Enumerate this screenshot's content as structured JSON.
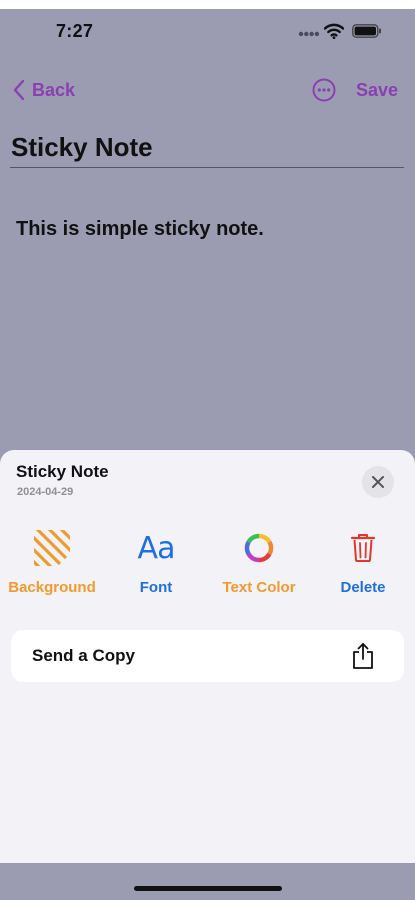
{
  "status_bar": {
    "time": "7:27"
  },
  "nav": {
    "back_label": "Back",
    "save_label": "Save",
    "accent_color": "#8a3fb3"
  },
  "note": {
    "title": "Sticky Note",
    "body": "This is simple sticky note."
  },
  "sheet": {
    "title": "Sticky Note",
    "date": "2024-04-29",
    "actions": [
      {
        "label": "Background",
        "icon": "stripes-icon",
        "color": "#f29a2e"
      },
      {
        "label": "Font",
        "icon": "font-aa-icon",
        "color": "#1f6fe0"
      },
      {
        "label": "Text Color",
        "icon": "color-wheel-icon",
        "color": "#f29a2e"
      },
      {
        "label": "Delete",
        "icon": "trash-icon",
        "color": "#1f6fe0"
      }
    ],
    "send_copy_label": "Send a Copy",
    "font_glyph": "Aa"
  }
}
